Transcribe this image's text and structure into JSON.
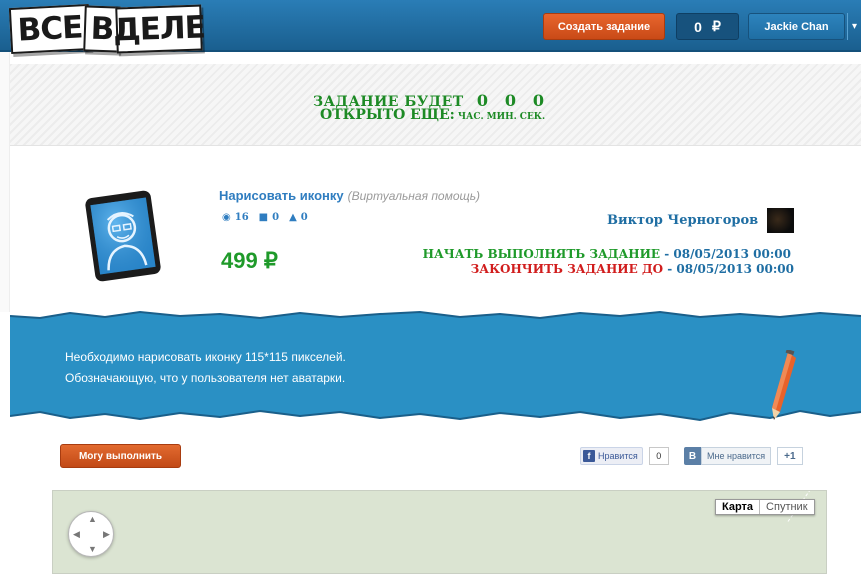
{
  "header": {
    "logo": [
      "ВСЕ",
      "В",
      "ДЕЛЕ"
    ],
    "create_task_label": "Создать задание",
    "balance_value": "0",
    "currency_symbol": "₽",
    "user_name": "Jackie Chan",
    "caret": "▾"
  },
  "timer": {
    "label_line1": "ЗАДАНИЕ БУДЕТ",
    "label_line2": "ОТКРЫТО ЕЩЕ:",
    "hours": "0",
    "minutes": "0",
    "seconds": "0",
    "unit_hours": "ЧАС.",
    "unit_minutes": "МИН.",
    "unit_seconds": "СЕК."
  },
  "task": {
    "title": "Нарисовать иконку",
    "category": "(Виртуальная помощь)",
    "views": "16",
    "comments": "0",
    "users": "0",
    "price": "499 ₽",
    "author": "Виктор Черногоров",
    "start_label": "НАЧАТЬ ВЫПОЛНЯТЬ ЗАДАНИЕ",
    "start_date": "- 08/05/2013 00:00",
    "end_label": "ЗАКОНЧИТЬ ЗАДАНИЕ ДО",
    "end_date": "- 08/05/2013 00:00",
    "description_line1": "Необходимо нарисовать иконку 115*115 пикселей.",
    "description_line2": "Обозначающую, что у пользователя нет аватарки."
  },
  "actions": {
    "can_do_label": "Могу выполнить",
    "fb_like_label": "Нравится",
    "fb_like_count": "0",
    "vk_letter": "В",
    "vk_like_label": "Мне нравится",
    "vk_count": "+1"
  },
  "map": {
    "type_map": "Карта",
    "type_satellite": "Спутник"
  },
  "icons": {
    "views": "eye-icon",
    "comments": "comment-icon",
    "users": "user-icon"
  },
  "colors": {
    "header_blue": "#1f6ea3",
    "accent_orange": "#d9561f",
    "green": "#1f9a2a",
    "red": "#d11d1d",
    "band_blue": "#2a90c4"
  }
}
